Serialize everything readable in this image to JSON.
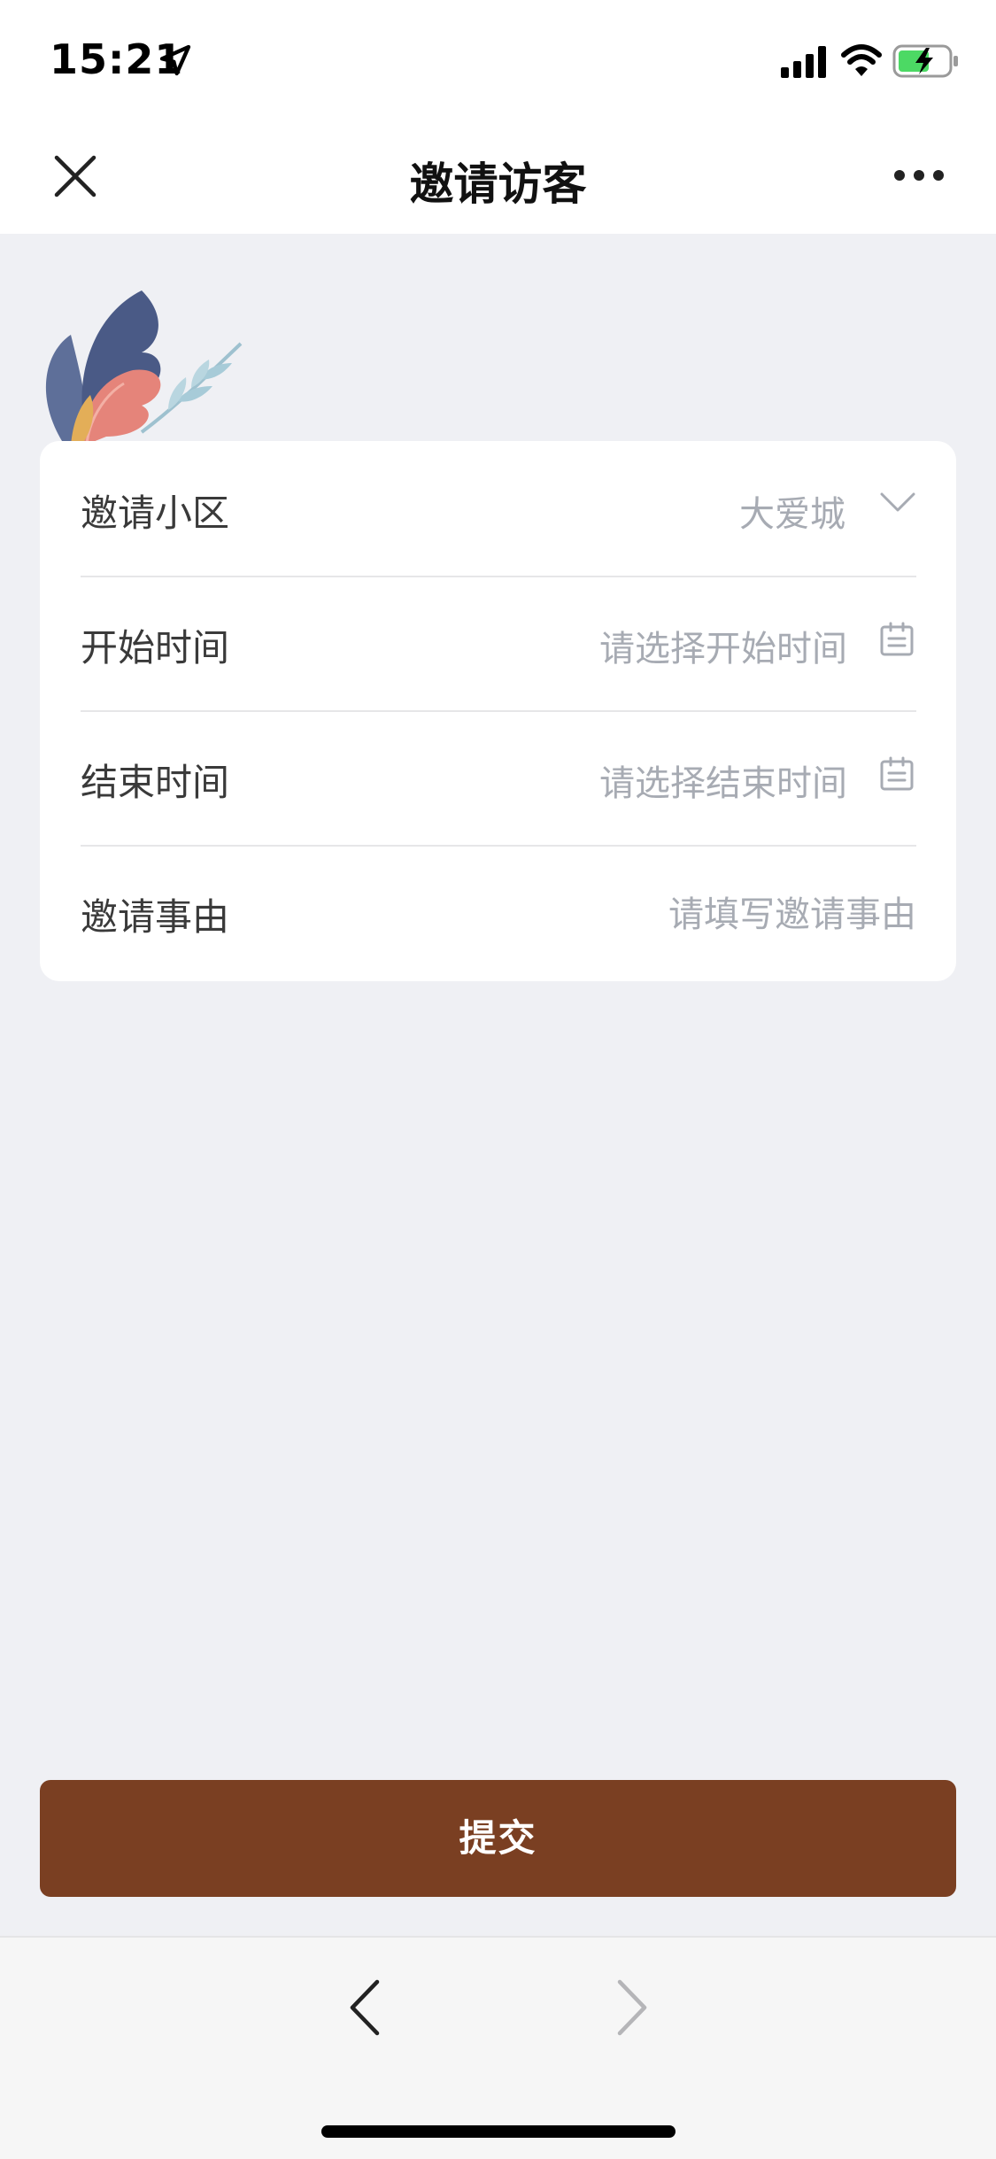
{
  "status_bar": {
    "time": "15:21",
    "icons": [
      "location-arrow-icon",
      "cellular-signal-icon",
      "wifi-icon",
      "battery-charging-icon"
    ]
  },
  "nav": {
    "title": "邀请访客",
    "close_icon": "close-icon",
    "more_icon": "more-icon"
  },
  "form": {
    "rows": [
      {
        "label": "邀请小区",
        "value": "大爱城",
        "icon": "chevron-down-icon"
      },
      {
        "label": "开始时间",
        "placeholder": "请选择开始时间",
        "icon": "calendar-icon"
      },
      {
        "label": "结束时间",
        "placeholder": "请选择结束时间",
        "icon": "calendar-icon"
      },
      {
        "label": "邀请事由",
        "placeholder": "请填写邀请事由"
      }
    ]
  },
  "submit": {
    "label": "提交"
  },
  "bottom_nav": {
    "back_icon": "back-arrow-icon",
    "forward_icon": "forward-arrow-icon"
  },
  "colors": {
    "accent": "#7a3f22",
    "page_bg": "#eff0f4",
    "placeholder": "#a7abb3",
    "battery_green": "#4cd964"
  }
}
